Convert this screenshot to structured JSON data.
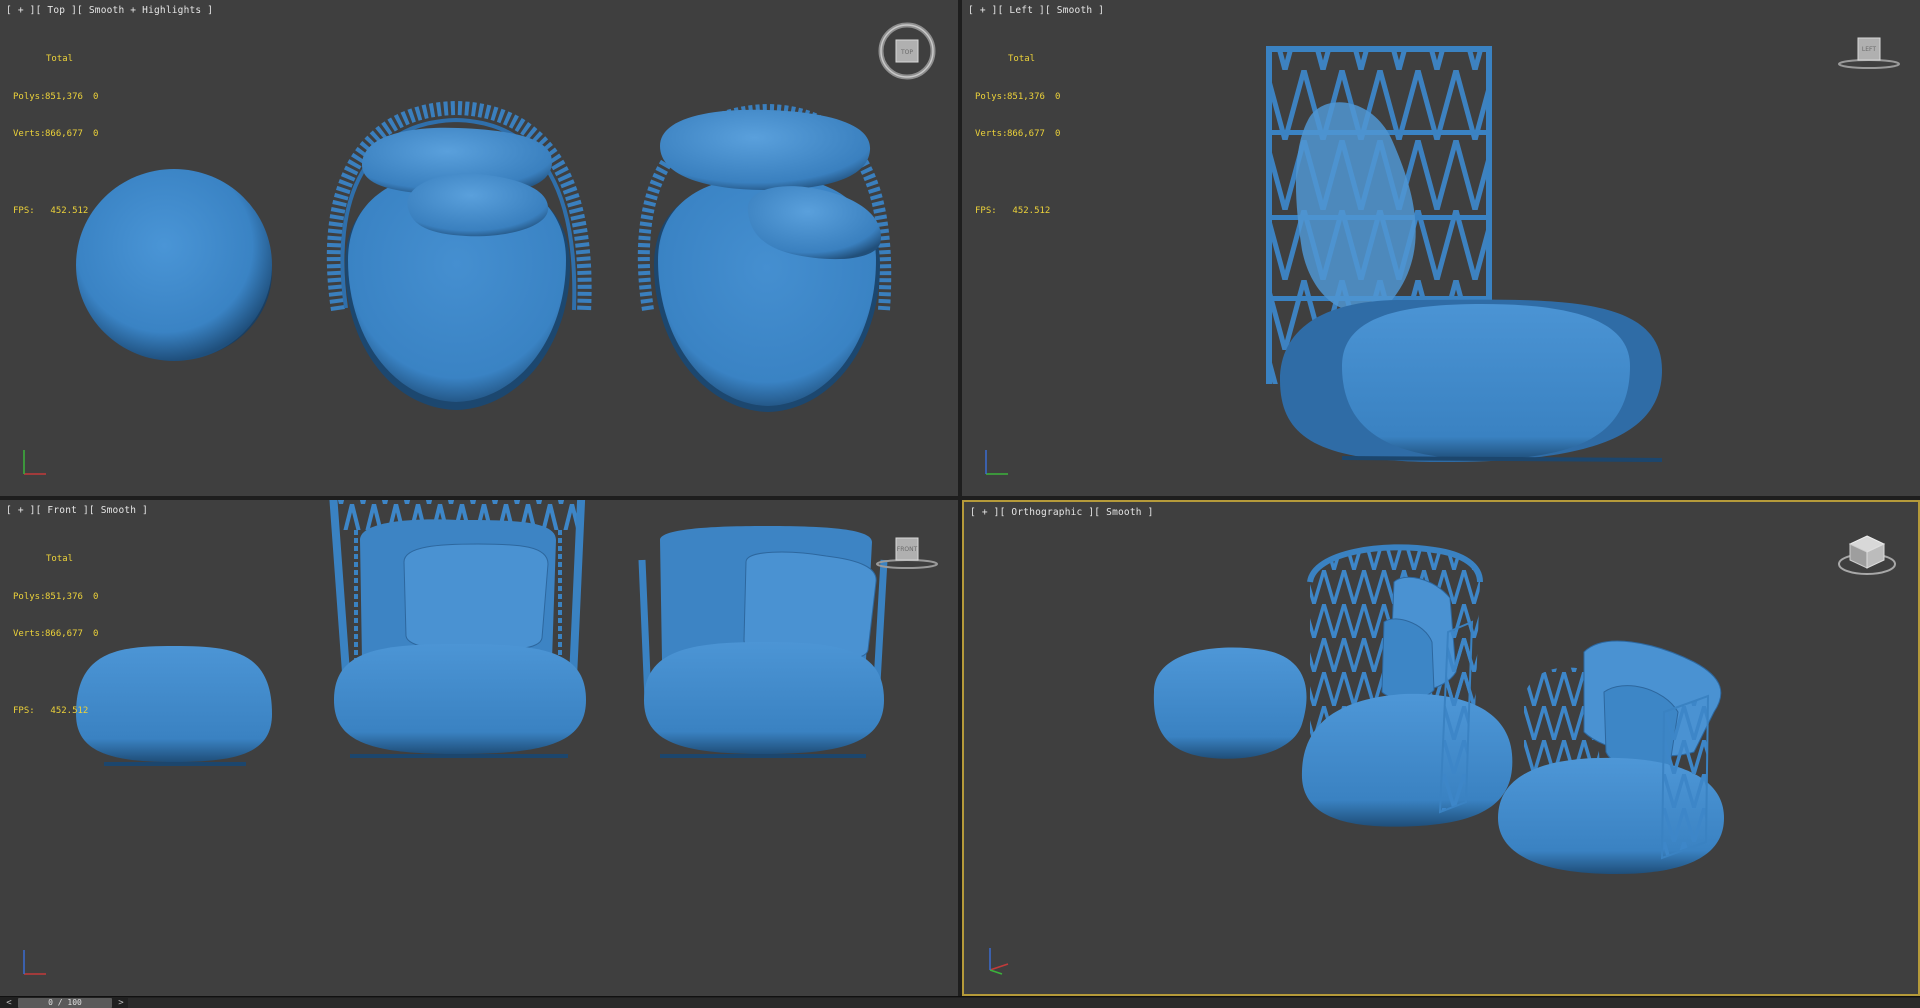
{
  "colors": {
    "viewport_bg": "#3f3f3f",
    "active_border": "#b59a3a",
    "stats_text": "#ecd23a",
    "model": "#3f88c9",
    "model_dark": "#20507d",
    "model_light": "#6fb0e6"
  },
  "stats": {
    "total_label": "Total",
    "polys_label": "Polys:",
    "polys_value": "851,376",
    "polys_sel": "0",
    "verts_label": "Verts:",
    "verts_value": "866,677",
    "verts_sel": "0",
    "fps_label": "FPS:",
    "fps_value": "452.512"
  },
  "viewports": {
    "top": {
      "label": "[ + ][ Top ][ Smooth + Highlights ]",
      "cube_face": "TOP"
    },
    "left": {
      "label": "[ + ][ Left ][ Smooth ]",
      "cube_face": "LEFT"
    },
    "front": {
      "label": "[ + ][ Front ][ Smooth ]",
      "cube_face": "FRONT"
    },
    "persp": {
      "label": "[ + ][ Orthographic ][ Smooth ]",
      "cube_face": ""
    }
  },
  "timeline": {
    "prev": "<",
    "next": ">",
    "frame_label": "0 / 100",
    "current_frame": 0,
    "total_frames": 100
  }
}
